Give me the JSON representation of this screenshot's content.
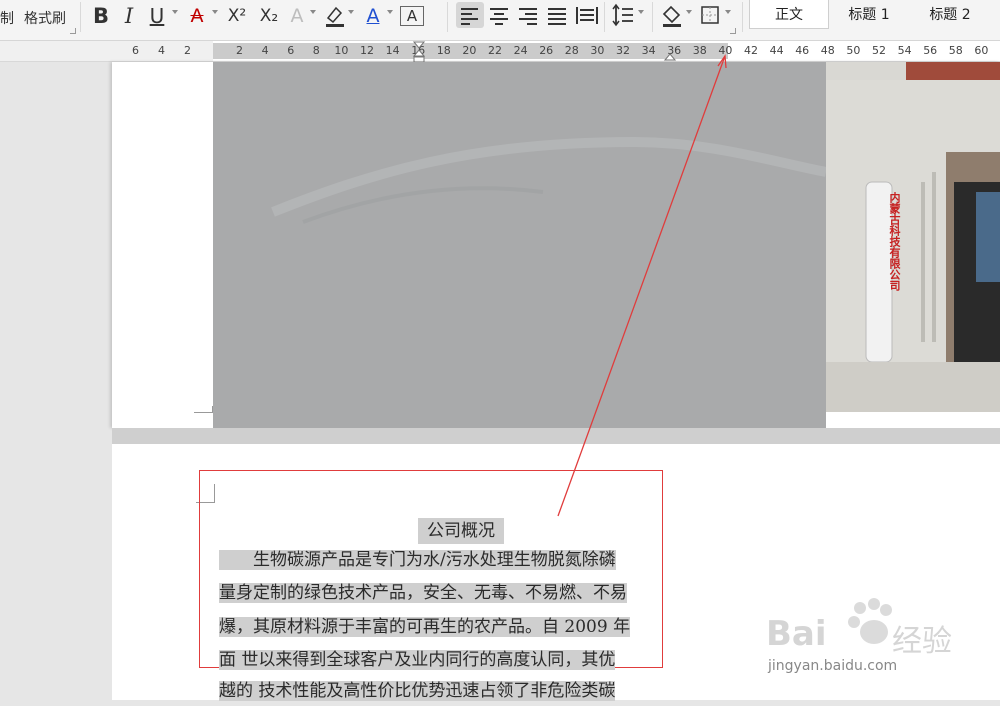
{
  "toolbar": {
    "left_fragment": "制",
    "format_painter": "格式刷",
    "bold": "B",
    "italic": "I",
    "underline": "U",
    "strikethrough": "A",
    "superscript": "X²",
    "subscript": "X₂",
    "text_effect": "A",
    "highlight_icon": "highlighter-icon",
    "font_color": "A",
    "char_border": "A",
    "align_left": "align-left-icon",
    "align_center": "align-center-icon",
    "align_right": "align-right-icon",
    "justify": "justify-icon",
    "distributed": "distributed-icon",
    "line_spacing": "line-spacing-icon",
    "shading": "shading-icon",
    "borders": "borders-icon",
    "styles": {
      "normal": "正文",
      "heading1": "标题 1",
      "heading2": "标题 2"
    },
    "accent_color": "#c00000"
  },
  "ruler": {
    "left_numbers": [
      "6",
      "4",
      "2"
    ],
    "right_numbers": [
      "2",
      "4",
      "6",
      "8",
      "10",
      "12",
      "14",
      "16",
      "18",
      "20",
      "22",
      "24",
      "26",
      "28",
      "30",
      "32",
      "34",
      "36",
      "38",
      "40",
      "42",
      "44",
      "46",
      "48",
      "50",
      "52",
      "54",
      "56",
      "58",
      "60"
    ]
  },
  "document": {
    "title": "公司概况",
    "lines": [
      "　　生物碳源产品是专门为水/污水处理生物脱氮除磷",
      "量身定制的绿色技术产品，安全、无毒、不易燃、不易",
      "爆，其原材料源于丰富的可再生的农产品。自 2009 年",
      "面 世以来得到全球客户及业内同行的高度认同，其优",
      "越的 技术性能及高性价比优势迅速占领了非危险类碳"
    ],
    "photo_sign": "内蒙古科技有限公司"
  },
  "watermark": {
    "brand": "Bai",
    "suffix": "经验",
    "url": "jingyan.baidu.com"
  }
}
